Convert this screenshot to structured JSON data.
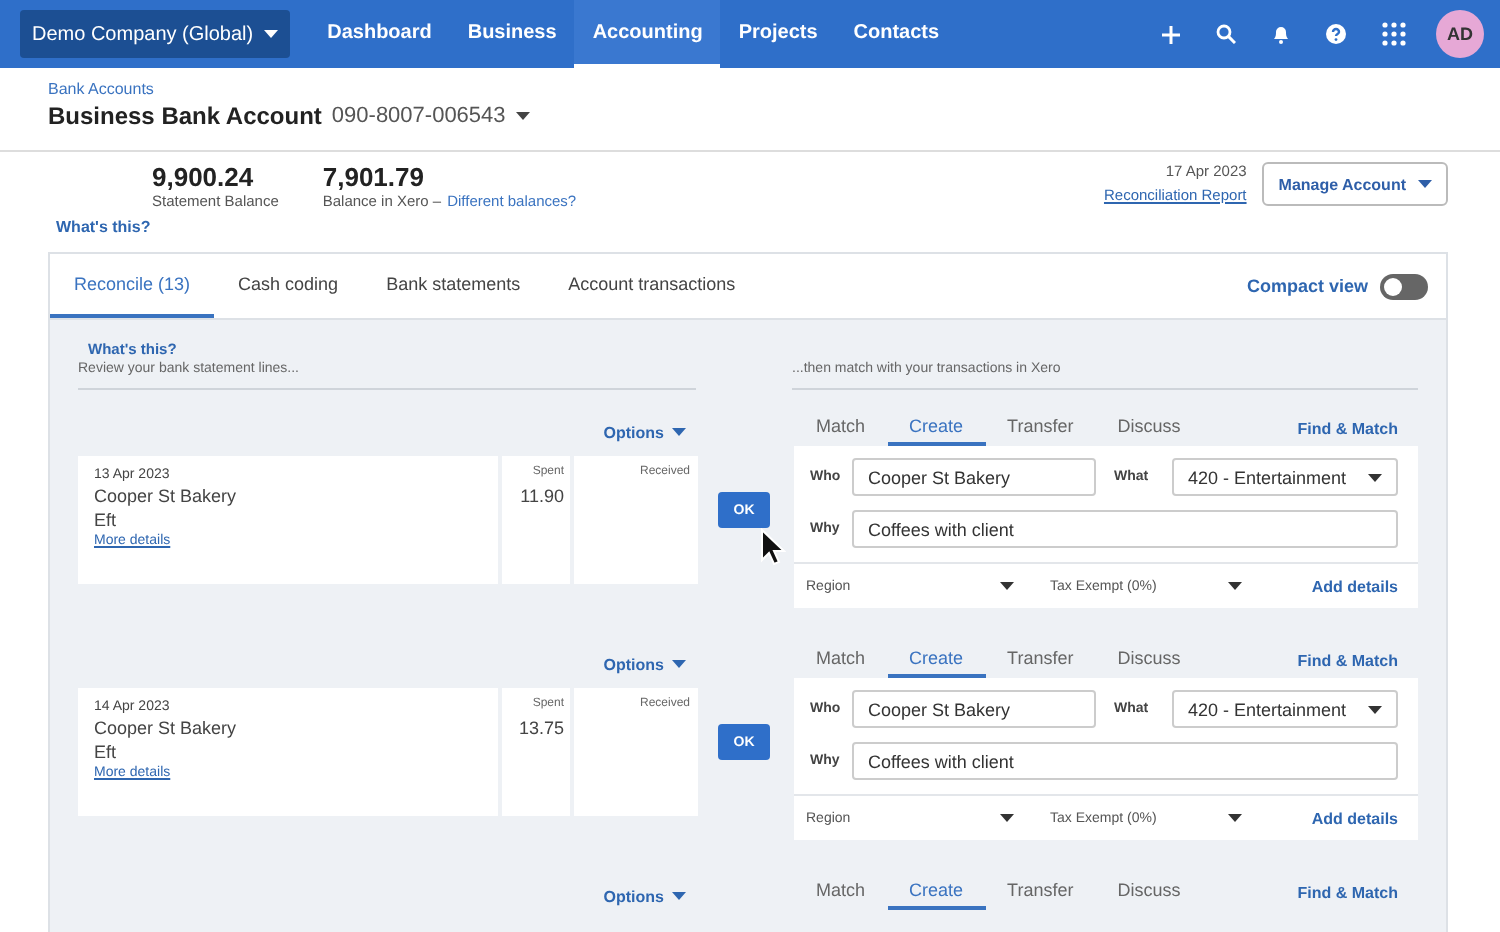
{
  "nav": {
    "company": "Demo Company (Global)",
    "links": [
      {
        "label": "Dashboard",
        "selected": false
      },
      {
        "label": "Business",
        "selected": false
      },
      {
        "label": "Accounting",
        "selected": true
      },
      {
        "label": "Projects",
        "selected": false
      },
      {
        "label": "Contacts",
        "selected": false
      }
    ],
    "avatar": "AD"
  },
  "header": {
    "breadcrumb": "Bank Accounts",
    "account_name": "Business Bank Account",
    "account_number": "090-8007-006543"
  },
  "balances": {
    "statement_amount": "9,900.24",
    "statement_label": "Statement Balance",
    "xero_amount": "7,901.79",
    "xero_label": "Balance in Xero –",
    "xero_link": "Different balances?",
    "whats_this": "What's this?",
    "date": "17 Apr 2023",
    "report_link": "Reconciliation Report",
    "manage_button": "Manage Account"
  },
  "tabs": [
    {
      "label": "Reconcile (13)",
      "selected": true
    },
    {
      "label": "Cash coding",
      "selected": false
    },
    {
      "label": "Bank statements",
      "selected": false
    },
    {
      "label": "Account transactions",
      "selected": false
    }
  ],
  "compact_view": {
    "label": "Compact view",
    "on": false
  },
  "left_intro": {
    "whats_this": "What's this?",
    "text": "Review your bank statement lines..."
  },
  "right_intro": {
    "text": "...then match with your transactions in Xero"
  },
  "transactions": [
    {
      "options": "Options",
      "date": "13 Apr 2023",
      "payee": "Cooper St Bakery",
      "type": "Eft",
      "more": "More details",
      "spent_label": "Spent",
      "spent": "11.90",
      "received_label": "Received",
      "ok": "OK",
      "match_tabs": [
        {
          "label": "Match",
          "selected": false
        },
        {
          "label": "Create",
          "selected": true
        },
        {
          "label": "Transfer",
          "selected": false
        },
        {
          "label": "Discuss",
          "selected": false
        }
      ],
      "find_match": "Find & Match",
      "who_label": "Who",
      "who": "Cooper St Bakery",
      "what_label": "What",
      "what": "420 - Entertainment",
      "why_label": "Why",
      "why": "Coffees with client",
      "region": "Region",
      "tax": "Tax Exempt (0%)",
      "add_details": "Add details"
    },
    {
      "options": "Options",
      "date": "14 Apr 2023",
      "payee": "Cooper St Bakery",
      "type": "Eft",
      "more": "More details",
      "spent_label": "Spent",
      "spent": "13.75",
      "received_label": "Received",
      "ok": "OK",
      "match_tabs": [
        {
          "label": "Match",
          "selected": false
        },
        {
          "label": "Create",
          "selected": true
        },
        {
          "label": "Transfer",
          "selected": false
        },
        {
          "label": "Discuss",
          "selected": false
        }
      ],
      "find_match": "Find & Match",
      "who_label": "Who",
      "who": "Cooper St Bakery",
      "what_label": "What",
      "what": "420 - Entertainment",
      "why_label": "Why",
      "why": "Coffees with client",
      "region": "Region",
      "tax": "Tax Exempt (0%)",
      "add_details": "Add details"
    }
  ],
  "next_transaction": {
    "options": "Options",
    "match_tabs": [
      {
        "label": "Match",
        "selected": false
      },
      {
        "label": "Create",
        "selected": true
      },
      {
        "label": "Transfer",
        "selected": false
      },
      {
        "label": "Discuss",
        "selected": false
      }
    ],
    "find_match": "Find & Match"
  }
}
